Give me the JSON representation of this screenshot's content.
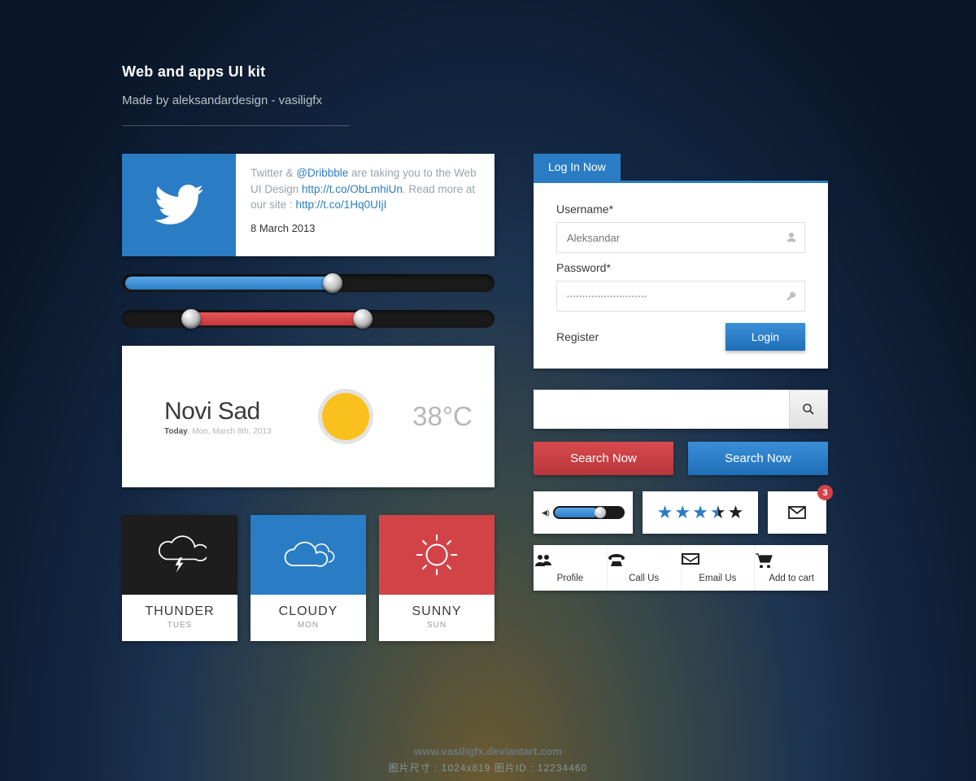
{
  "header": {
    "title": "Web and apps UI kit",
    "subtitle": "Made by aleksandardesign - vasiligfx"
  },
  "twitter": {
    "t1": "Twitter & ",
    "handle": "@Dribbble",
    "t2": " are taking you to the Web UI Design ",
    "link1": "http://t.co/ObLmhiUn",
    "t3": ". Read more at our site : ",
    "link2": "http://t.co/1Hq0UIjI",
    "date": "8 March 2013"
  },
  "sliders": {
    "single_value_pct": 56,
    "range_start_pct": 18,
    "range_end_pct": 64
  },
  "weather": {
    "city": "Novi Sad",
    "today_label": "Today",
    "date": ", Mon, March 8th, 2013",
    "temp": "38°C"
  },
  "forecast": [
    {
      "name": "THUNDER",
      "day": "TUES"
    },
    {
      "name": "CLOUDY",
      "day": "MON"
    },
    {
      "name": "SUNNY",
      "day": "SUN"
    }
  ],
  "login": {
    "tab": "Log In Now",
    "username_label": "Username*",
    "username_placeholder": "Aleksandar",
    "password_label": "Password*",
    "password_value": "••••••••••••••••••••••••••",
    "register": "Register",
    "login_btn": "Login"
  },
  "search": {
    "btn_red": "Search Now",
    "btn_blue": "Search Now"
  },
  "mini": {
    "volume_pct": 60,
    "rating_stars": 3.5,
    "mail_badge": "3"
  },
  "nav": [
    {
      "label": "Profile"
    },
    {
      "label": "Call Us"
    },
    {
      "label": "Email Us"
    },
    {
      "label": "Add to cart"
    }
  ],
  "footer": {
    "url": "www.vasiligfx.deviantart.com",
    "id": "图片尺寸 : 1024x819   图片ID : 12234460"
  }
}
